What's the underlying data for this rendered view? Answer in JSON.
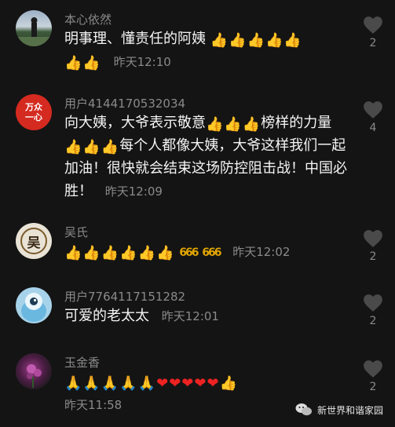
{
  "comments": [
    {
      "username": "本心依然",
      "text": "明事理、懂责任的阿姨",
      "emoji_line": [
        "👍",
        "👍",
        "👍",
        "👍",
        "👍",
        "👍",
        "👍"
      ],
      "time": "昨天12:10",
      "likes": "2",
      "avatar_icon": "landscape-avatar"
    },
    {
      "username": "用户4144170532034",
      "text_a": "向大姨，大爷表示敬意",
      "text_b": "榜样的",
      "text_c": "力量",
      "text_d": "每个人都像大姨，大爷这样我们一起加油！很快就会结束这场防控阻击战！中国必胜！",
      "time": "昨天12:09",
      "likes": "4",
      "avatar_text": "万众一心"
    },
    {
      "username": "吴氏",
      "hint": "666",
      "time": "昨天12:02",
      "likes": "2",
      "avatar_text": "吴"
    },
    {
      "username": "用户7764117151282",
      "text": "可爱的老太太",
      "time": "昨天12:01",
      "likes": "2",
      "avatar_icon": "cartoon-creature-avatar"
    },
    {
      "username": "玉金香",
      "time": "昨天11:58",
      "likes": "2",
      "avatar_icon": "flower-avatar"
    }
  ],
  "watermark": {
    "label": "新世界和谐家园",
    "icon": "wechat-icon"
  },
  "colors": {
    "background": "#141414",
    "username": "#8a8a8a",
    "text": "#f5f5f5",
    "heart": "#e22"
  }
}
